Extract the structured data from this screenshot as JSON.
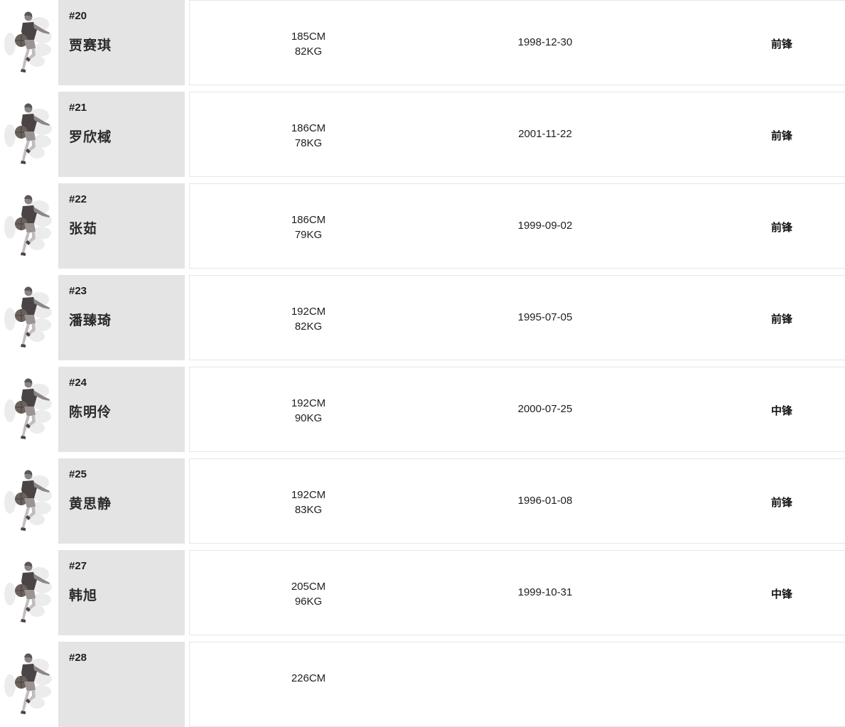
{
  "players": [
    {
      "number": "#20",
      "name": "贾赛琪",
      "height": "185CM",
      "weight": "82KG",
      "birthdate": "1998-12-30",
      "position": "前锋"
    },
    {
      "number": "#21",
      "name": "罗欣棫",
      "height": "186CM",
      "weight": "78KG",
      "birthdate": "2001-11-22",
      "position": "前锋"
    },
    {
      "number": "#22",
      "name": "张茹",
      "height": "186CM",
      "weight": "79KG",
      "birthdate": "1999-09-02",
      "position": "前锋"
    },
    {
      "number": "#23",
      "name": "潘臻琦",
      "height": "192CM",
      "weight": "82KG",
      "birthdate": "1995-07-05",
      "position": "前锋"
    },
    {
      "number": "#24",
      "name": "陈明伶",
      "height": "192CM",
      "weight": "90KG",
      "birthdate": "2000-07-25",
      "position": "中锋"
    },
    {
      "number": "#25",
      "name": "黄思静",
      "height": "192CM",
      "weight": "83KG",
      "birthdate": "1996-01-08",
      "position": "前锋"
    },
    {
      "number": "#27",
      "name": "韩旭",
      "height": "205CM",
      "weight": "96KG",
      "birthdate": "1999-10-31",
      "position": "中锋"
    },
    {
      "number": "#28",
      "name": "",
      "height": "226CM",
      "weight": "",
      "birthdate": "",
      "position": ""
    }
  ],
  "photo_icon": "player-silhouette-icon"
}
